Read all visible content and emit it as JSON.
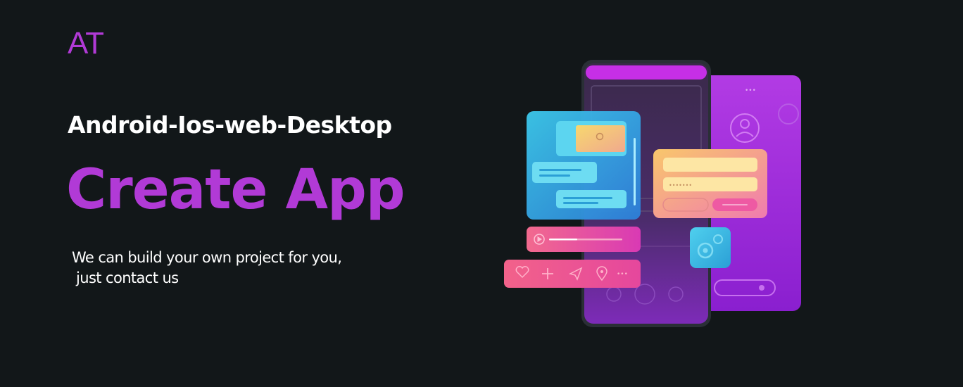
{
  "logo": {
    "text": "AT"
  },
  "hero": {
    "subtitle": "Android-Ios-web-Desktop",
    "headline": "Create App",
    "tagline_line1": "We can build your own project for you,",
    "tagline_line2": "just contact us"
  },
  "illustration": {
    "password_mask": "•••••••",
    "menu_dots": "•••"
  },
  "colors": {
    "background": "#121719",
    "accent": "#b13ad6",
    "text": "#ffffff",
    "cyan": "#3ec8e8",
    "pink": "#ec4e9a",
    "yellow": "#f7dc7a",
    "purple": "#a02ad8"
  }
}
